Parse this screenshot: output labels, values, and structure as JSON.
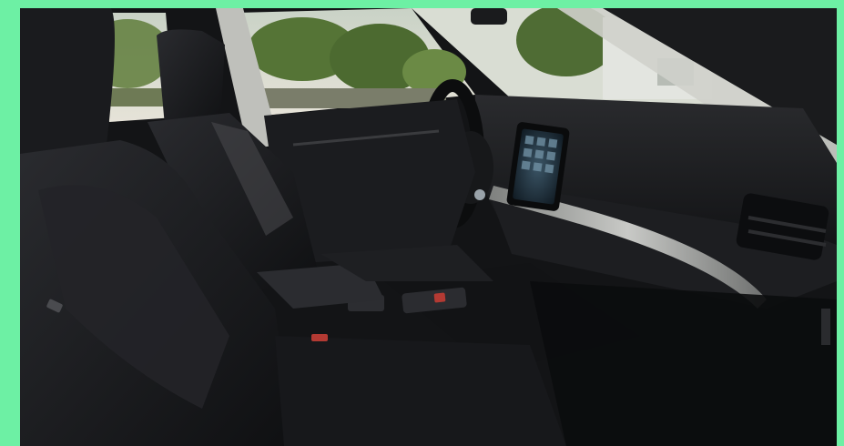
{
  "frame": {
    "border_color": "#6df0a4"
  },
  "photo": {
    "subject": "car-interior",
    "colors": {
      "upholstery": "#1b1c1f",
      "dashboard": "#151618",
      "trim": "#a9aaa8",
      "foliage": "#5f7d3b",
      "sky": "#d6dccf",
      "screen": "#20303b"
    }
  }
}
